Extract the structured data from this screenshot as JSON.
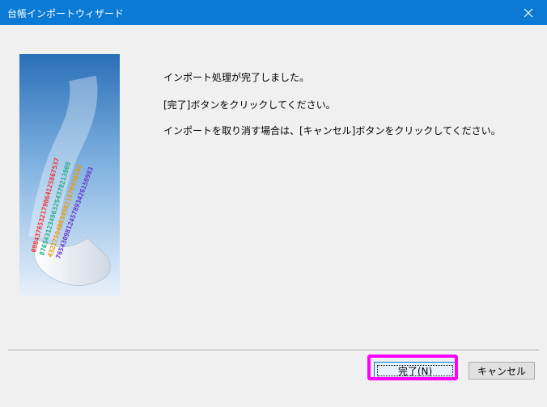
{
  "window": {
    "title": "台帳インポートウィザード",
    "close_icon": "close-icon"
  },
  "content": {
    "messages": [
      "インポート処理が完了しました。",
      "[完了]ボタンをクリックしてください。",
      "インポートを取り消す場合は、[キャンセル]ボタンをクリックしてください。"
    ],
    "illustration_digits": [
      "0984376532179064125867537",
      "8765431234963254378213908",
      "4321759406345821978430562",
      "7654309812457893426150983"
    ]
  },
  "buttons": {
    "finish_label": "完了(N)",
    "cancel_label": "キャンセル"
  },
  "colors": {
    "title_bar": "#0a7ad4",
    "highlight": "#ff00ff",
    "background": "#f0f0f0"
  }
}
